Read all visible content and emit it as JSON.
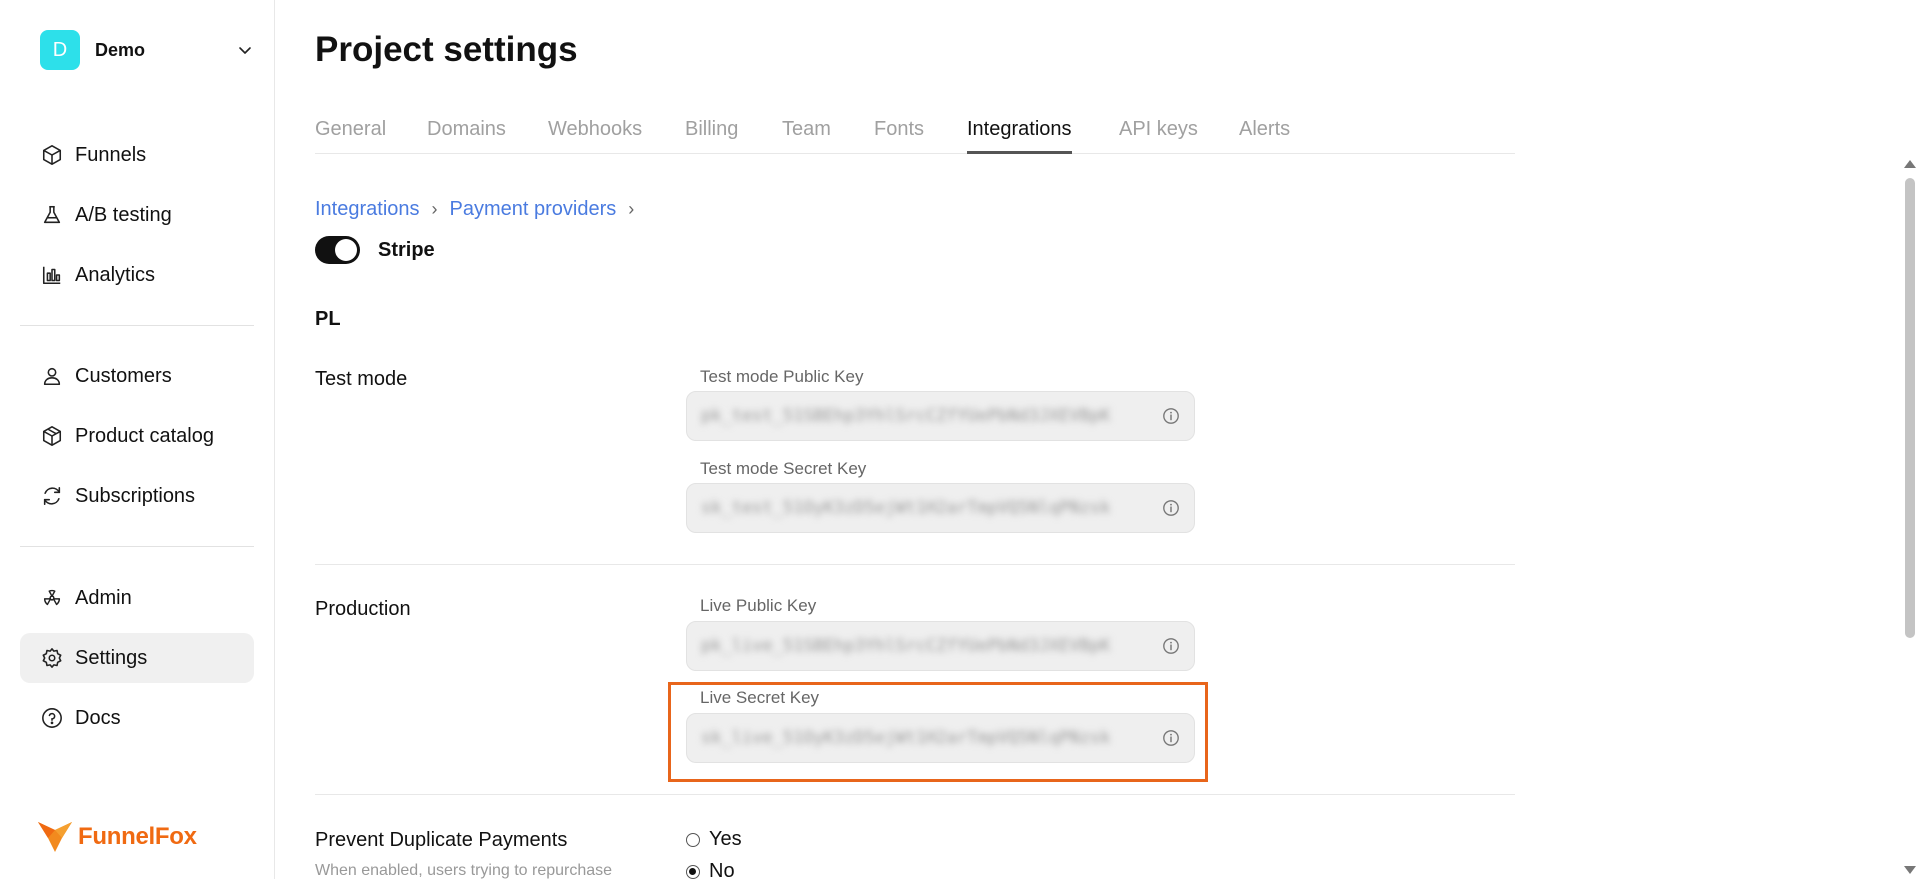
{
  "workspace": {
    "initial": "D",
    "name": "Demo",
    "color": "#2de0ea"
  },
  "sidebar": {
    "items": [
      {
        "label": "Funnels",
        "icon": "cube-icon"
      },
      {
        "label": "A/B testing",
        "icon": "flask-icon"
      },
      {
        "label": "Analytics",
        "icon": "bar-chart-icon"
      },
      {
        "label": "Customers",
        "icon": "user-icon"
      },
      {
        "label": "Product catalog",
        "icon": "box-icon"
      },
      {
        "label": "Subscriptions",
        "icon": "refresh-icon"
      },
      {
        "label": "Admin",
        "icon": "radiation-icon"
      },
      {
        "label": "Settings",
        "icon": "gear-icon",
        "active": true
      },
      {
        "label": "Docs",
        "icon": "help-circle-icon"
      }
    ],
    "logo_text": "FunnelFox"
  },
  "page": {
    "title": "Project settings"
  },
  "tabs": [
    {
      "label": "General"
    },
    {
      "label": "Domains"
    },
    {
      "label": "Webhooks"
    },
    {
      "label": "Billing"
    },
    {
      "label": "Team"
    },
    {
      "label": "Fonts"
    },
    {
      "label": "Integrations",
      "active": true
    },
    {
      "label": "API keys"
    },
    {
      "label": "Alerts"
    }
  ],
  "breadcrumb": {
    "items": [
      "Integrations",
      "Payment providers"
    ],
    "separator": "›"
  },
  "provider": {
    "name": "Stripe",
    "enabled": true
  },
  "section": {
    "title": "PL"
  },
  "test_mode": {
    "label": "Test mode",
    "public_key_label": "Test mode Public Key",
    "public_key_value": "pk_test_51SBEhp3YhlSrcCZfYUePbNd3JXEVBpK",
    "secret_key_label": "Test mode Secret Key",
    "secret_key_value": "sk_test_51OyK3zD5ejWt1H2arTmpVQ5NlqPNzsk"
  },
  "production": {
    "label": "Production",
    "public_key_label": "Live Public Key",
    "public_key_value": "pk_live_51SBEhp3YhlSrcCZfYUePbNd3JXEVBpK",
    "secret_key_label": "Live Secret Key",
    "secret_key_value": "sk_live_51OyK3zD5ejWt1H2arTmpVQ5NlqPNzsk"
  },
  "duplicate_payments": {
    "label": "Prevent Duplicate Payments",
    "description": "When enabled, users trying to repurchase",
    "options": [
      {
        "label": "Yes",
        "checked": false
      },
      {
        "label": "No",
        "checked": true
      }
    ]
  },
  "colors": {
    "accent_link": "#4a7be0",
    "highlight": "#e8651b",
    "brand": "#f06a12"
  }
}
